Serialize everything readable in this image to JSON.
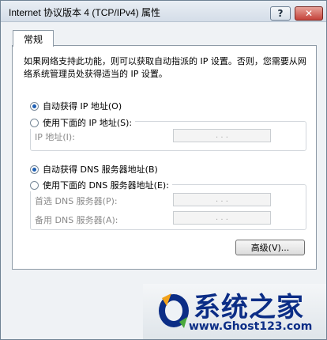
{
  "window": {
    "title": "Internet 协议版本 4 (TCP/IPv4) 属性",
    "help_label": "?",
    "close_label": "✕"
  },
  "tabs": [
    {
      "label": "常规",
      "selected": true
    }
  ],
  "description": "如果网络支持此功能，则可以获取自动指派的 IP 设置。否则，您需要从网络系统管理员处获得适当的 IP 设置。",
  "ip": {
    "auto_label": "自动获得 IP 地址(O)",
    "auto_selected": true,
    "manual_label": "使用下面的 IP 地址(S):",
    "manual_selected": false,
    "address_label": "IP 地址(I):",
    "address_value": ". . ."
  },
  "dns": {
    "auto_label": "自动获得 DNS 服务器地址(B)",
    "auto_selected": true,
    "manual_label": "使用下面的 DNS 服务器地址(E):",
    "manual_selected": false,
    "preferred_label": "首选 DNS 服务器(P):",
    "preferred_value": ". . .",
    "alternate_label": "备用 DNS 服务器(A):",
    "alternate_value": ". . ."
  },
  "advanced_label": "高级(V)...",
  "watermark": {
    "name": "系统之家",
    "url": "www.Ghost123.com"
  },
  "colors": {
    "accent": "#1e5fb3",
    "watermark": "#0b2d86",
    "close": "#c4423a"
  }
}
